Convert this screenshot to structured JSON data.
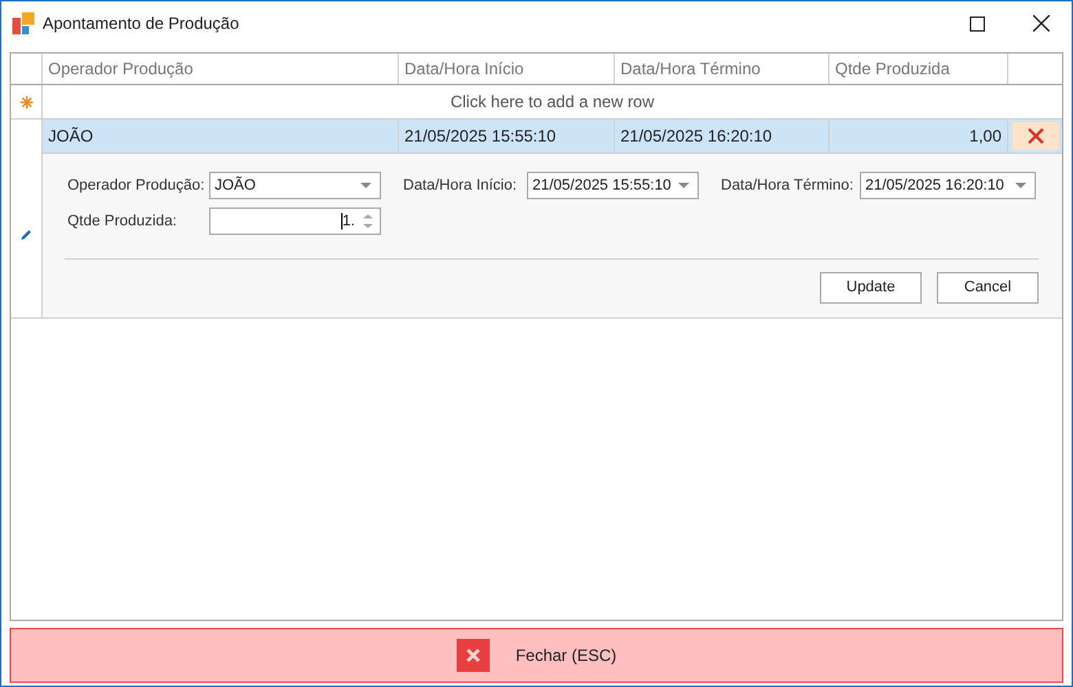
{
  "window": {
    "title": "Apontamento de Produção"
  },
  "table": {
    "columns": [
      "Operador Produção",
      "Data/Hora Início",
      "Data/Hora Término",
      "Qtde Produzida"
    ],
    "new_row_text": "Click here to add a new row",
    "rows": [
      {
        "cells": [
          "JOÃO",
          "21/05/2025 15:55:10",
          "21/05/2025 16:20:10",
          "1,00"
        ],
        "selected": true
      }
    ]
  },
  "edit_form": {
    "fields": [
      {
        "label": "Operador Produção:",
        "value": "JOÃO",
        "kind": "combo"
      },
      {
        "label": "Data/Hora Início:",
        "value": "21/05/2025 15:55:10",
        "kind": "date"
      },
      {
        "label": "Data/Hora Término:",
        "value": "21/05/2025 16:20:10",
        "kind": "date"
      },
      {
        "label": "Qtde Produzida:",
        "value": "1.",
        "kind": "spin"
      }
    ],
    "buttons": [
      "Update",
      "Cancel"
    ]
  },
  "close_button": {
    "label": "Fechar (ESC)"
  }
}
